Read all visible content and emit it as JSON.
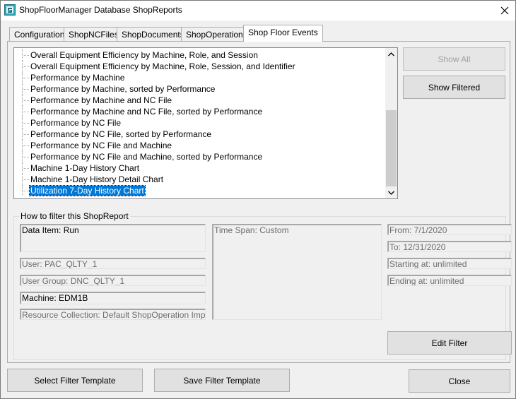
{
  "window": {
    "title": "ShopFloorManager Database ShopReports"
  },
  "tabs": [
    {
      "label": "Configuration"
    },
    {
      "label": "ShopNCFiles"
    },
    {
      "label": "ShopDocuments"
    },
    {
      "label": "ShopOperations"
    },
    {
      "label": "Shop Floor Events"
    }
  ],
  "reports": {
    "items": [
      {
        "label": "Overall Equipment Efficiency by Machine, Role, and Session"
      },
      {
        "label": "Overall Equipment Efficiency by Machine, Role, Session, and Identifier"
      },
      {
        "label": "Performance by Machine"
      },
      {
        "label": "Performance by Machine, sorted by Performance"
      },
      {
        "label": "Performance by Machine and NC File"
      },
      {
        "label": "Performance by Machine and NC File, sorted by Performance"
      },
      {
        "label": "Performance by NC File"
      },
      {
        "label": "Performance by NC File, sorted by Performance"
      },
      {
        "label": "Performance by NC File and Machine"
      },
      {
        "label": "Performance by NC File and Machine, sorted by Performance"
      },
      {
        "label": "Machine 1-Day History Chart"
      },
      {
        "label": "Machine 1-Day History Detail Chart"
      },
      {
        "label": "Utilization 7-Day History Chart"
      }
    ],
    "selected": "Utilization 7-Day History Chart"
  },
  "buttons": {
    "show_all": "Show All",
    "show_filtered": "Show Filtered",
    "edit_filter": "Edit Filter",
    "select_filter_template": "Select Filter Template",
    "save_filter_template": "Save Filter Template",
    "close": "Close"
  },
  "filter": {
    "group_label": "How to filter this ShopReport",
    "data_item": "Data Item: Run",
    "user": "User: PAC_QLTY_1",
    "user_group": "User Group: DNC_QLTY_1",
    "machine": "Machine: EDM1B",
    "resource_collection": "Resource Collection: Default ShopOperation Import",
    "time_span": "Time Span: Custom",
    "from": "From: 7/1/2020",
    "to": "To: 12/31/2020",
    "starting_at": "Starting at: unlimited",
    "ending_at": "Ending at: unlimited"
  },
  "colors": {
    "selection": "#0078d7",
    "accent_border": "#0078d7"
  }
}
